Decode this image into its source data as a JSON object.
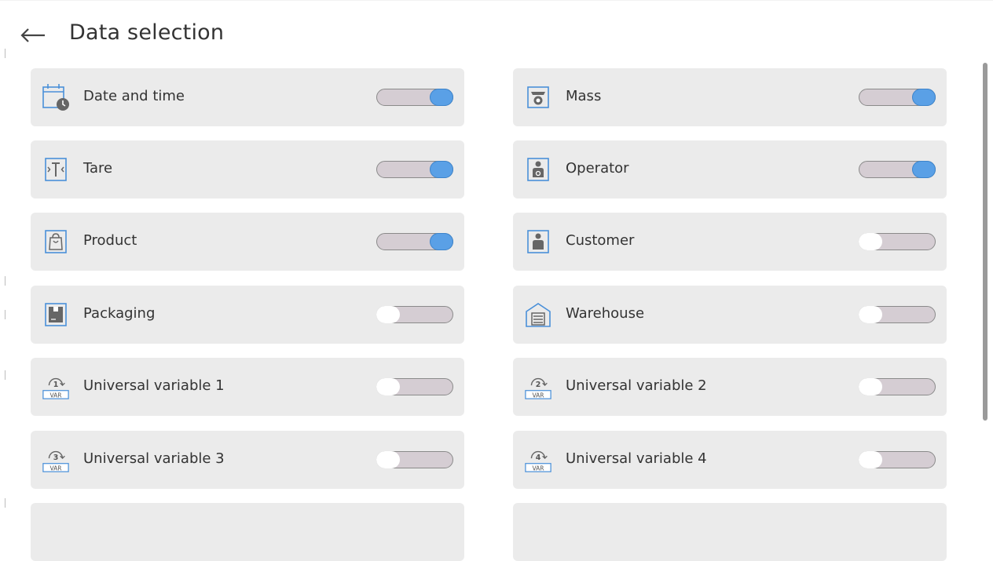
{
  "header": {
    "title": "Data selection"
  },
  "items": [
    {
      "label": "Date and time",
      "icon": "calendar-clock-icon",
      "checked": true
    },
    {
      "label": "Mass",
      "icon": "scale-icon",
      "checked": true
    },
    {
      "label": "Tare",
      "icon": "tare-icon",
      "checked": true
    },
    {
      "label": "Operator",
      "icon": "operator-icon",
      "checked": true
    },
    {
      "label": "Product",
      "icon": "product-bag-icon",
      "checked": true
    },
    {
      "label": "Customer",
      "icon": "customer-icon",
      "checked": false
    },
    {
      "label": "Packaging",
      "icon": "packaging-icon",
      "checked": false
    },
    {
      "label": "Warehouse",
      "icon": "warehouse-icon",
      "checked": false
    },
    {
      "label": "Universal variable 1",
      "icon": "variable-1-icon",
      "checked": false
    },
    {
      "label": "Universal variable 2",
      "icon": "variable-2-icon",
      "checked": false
    },
    {
      "label": "Universal variable 3",
      "icon": "variable-3-icon",
      "checked": false
    },
    {
      "label": "Universal variable 4",
      "icon": "variable-4-icon",
      "checked": false
    }
  ],
  "icons": {
    "var_tag": "VAR",
    "var_numbers": [
      "1",
      "2",
      "3",
      "4"
    ]
  },
  "colors": {
    "accent": "#5aa0e6",
    "item_bg": "#ebebeb",
    "toggle_track": "#d5cdd3",
    "icon_blue": "#4a90d9"
  }
}
